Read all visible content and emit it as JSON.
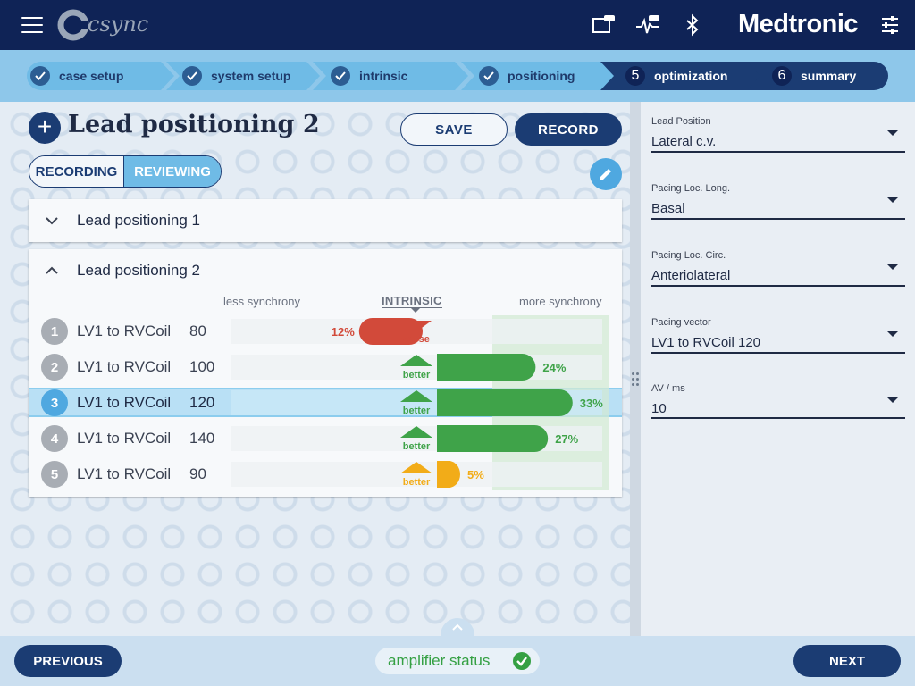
{
  "app": {
    "logo_text": "csync",
    "brand": "Medtronic"
  },
  "steps": [
    {
      "label": "case setup",
      "done": true
    },
    {
      "label": "system setup",
      "done": true
    },
    {
      "label": "intrinsic",
      "done": true
    },
    {
      "label": "positioning",
      "done": true
    },
    {
      "number": "5",
      "label": "optimization",
      "done": false
    },
    {
      "number": "6",
      "label": "summary",
      "done": false
    }
  ],
  "page": {
    "title": "Lead positioning 2"
  },
  "actions": {
    "save": "SAVE",
    "record": "RECORD"
  },
  "mode": {
    "recording": "RECORDING",
    "reviewing": "REVIEWING",
    "active": "REVIEWING"
  },
  "accordions": [
    {
      "label": "Lead positioning 1",
      "expanded": false
    },
    {
      "label": "Lead positioning 2",
      "expanded": true
    }
  ],
  "table": {
    "less": "less synchrony",
    "intrinsic": "INTRINSIC",
    "more": "more synchrony",
    "better_label": "better",
    "worse_label": "worse",
    "rows": [
      {
        "n": "1",
        "vector": "LV1 to RVCoil",
        "av": "80",
        "pct": "12%",
        "value": -12,
        "dir": "worse",
        "selected": false
      },
      {
        "n": "2",
        "vector": "LV1 to RVCoil",
        "av": "100",
        "pct": "24%",
        "value": 24,
        "dir": "better",
        "selected": false
      },
      {
        "n": "3",
        "vector": "LV1 to RVCoil",
        "av": "120",
        "pct": "33%",
        "value": 33,
        "dir": "better",
        "selected": true
      },
      {
        "n": "4",
        "vector": "LV1 to RVCoil",
        "av": "140",
        "pct": "27%",
        "value": 27,
        "dir": "better",
        "selected": false
      },
      {
        "n": "5",
        "vector": "LV1 to RVCoil",
        "av": "90",
        "pct": "5%",
        "value": 5,
        "dir": "better",
        "selected": false
      }
    ],
    "colors": {
      "worse": "#d24a3a",
      "better": "#3fa349",
      "small": "#f2ac18"
    }
  },
  "fields": [
    {
      "label": "Lead Position",
      "value": "Lateral c.v."
    },
    {
      "label": "Pacing Loc. Long.",
      "value": "Basal"
    },
    {
      "label": "Pacing Loc. Circ.",
      "value": "Anteriolateral"
    },
    {
      "label": "Pacing vector",
      "value": "LV1 to RVCoil 120"
    },
    {
      "label": "AV / ms",
      "value": "10"
    }
  ],
  "footer": {
    "previous": "PREVIOUS",
    "next": "NEXT",
    "amplifier": "amplifier status"
  },
  "icons": [
    "menu-icon",
    "tablet-icon",
    "ecg-monitor-icon",
    "bluetooth-icon",
    "settings-sliders-icon",
    "plus-icon",
    "pencil-icon",
    "chevron-down-icon",
    "chevron-up-icon",
    "check-icon",
    "dropdown-arrow-icon",
    "drag-grip-icon"
  ]
}
